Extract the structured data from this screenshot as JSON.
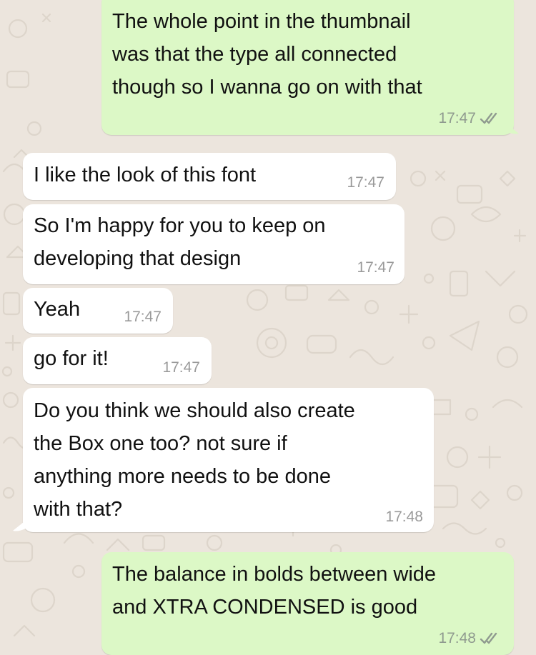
{
  "colors": {
    "background": "#ece5dd",
    "incoming_bubble": "#ffffff",
    "outgoing_bubble": "#dcf8c6",
    "read_ticks": "#8f9a8f"
  },
  "messages": [
    {
      "direction": "outgoing",
      "text": "The whole point in the thumbnail\nwas that the type all connected\nthough so I wanna go on with that",
      "time": "17:47",
      "ticks": "double-check-icon"
    },
    {
      "direction": "incoming",
      "text": "I like the look of this font",
      "time": "17:47"
    },
    {
      "direction": "incoming",
      "text": "So I'm happy for you to keep on\ndeveloping that design",
      "time": "17:47"
    },
    {
      "direction": "incoming",
      "text": "Yeah",
      "time": "17:47"
    },
    {
      "direction": "incoming",
      "text": "go for it!",
      "time": "17:47"
    },
    {
      "direction": "incoming",
      "text": "Do you think we should also create\nthe Box one too? not sure if\nanything more needs to be done\nwith that?",
      "time": "17:48"
    },
    {
      "direction": "outgoing",
      "text": "The balance in bolds between wide\nand XTRA CONDENSED is good",
      "time": "17:48",
      "ticks": "double-check-icon"
    }
  ]
}
